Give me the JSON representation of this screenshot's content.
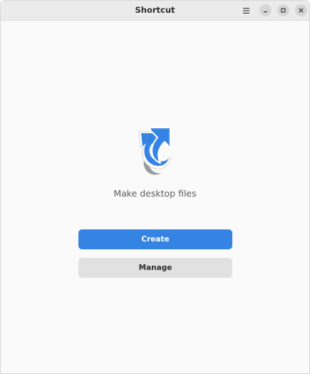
{
  "window": {
    "title": "Shortcut"
  },
  "header": {
    "menu_icon": "hamburger-menu-icon",
    "minimize_icon": "minimize-icon",
    "maximize_icon": "maximize-icon",
    "close_icon": "close-icon"
  },
  "main": {
    "app_icon": "shortcut-arrow-icon",
    "subtitle": "Make desktop files",
    "create_label": "Create",
    "manage_label": "Manage"
  },
  "colors": {
    "accent": "#3584e4",
    "secondary_button": "#e1e1e1",
    "background": "#fafafa",
    "headerbar": "#ebebeb"
  }
}
